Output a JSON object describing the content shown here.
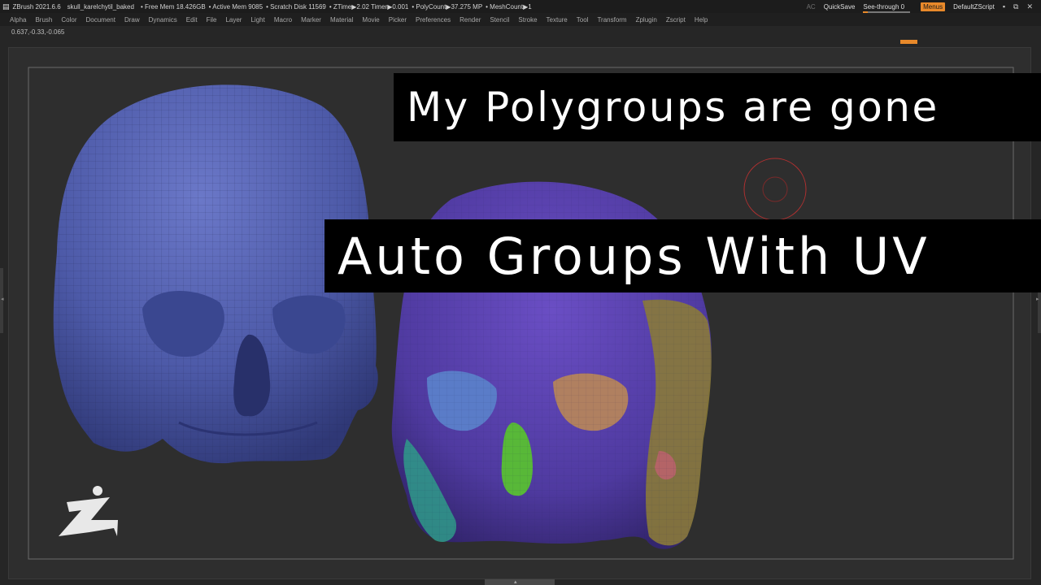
{
  "titlebar": {
    "app": "ZBrush 2021.6.6",
    "file": "skull_karelchytil_baked",
    "free_mem": "• Free Mem 18.426GB",
    "active_mem": "• Active Mem 9085",
    "scratch": "• Scratch Disk 11569",
    "ztime": "• ZTime▶2.02 Timer▶0.001",
    "polycount": "• PolyCount▶37.275 MP",
    "meshcount": "• MeshCount▶1",
    "ac": "AC",
    "quicksave": "QuickSave",
    "see_through": "See-through  0",
    "see_through_value": 0,
    "menus": "Menus",
    "default_script": "DefaultZScript",
    "accent_color": "#e8892a"
  },
  "menubar": {
    "items": [
      "Alpha",
      "Brush",
      "Color",
      "Document",
      "Draw",
      "Dynamics",
      "Edit",
      "File",
      "Layer",
      "Light",
      "Macro",
      "Marker",
      "Material",
      "Movie",
      "Picker",
      "Preferences",
      "Render",
      "Stencil",
      "Stroke",
      "Texture",
      "Tool",
      "Transform",
      "Zplugin",
      "Zscript",
      "Help"
    ]
  },
  "coords": "0.637,-0.33,-0.065",
  "overlay": {
    "line1": "My Polygroups are gone",
    "line2": "Auto Groups With UV"
  },
  "icons": {
    "brush_cursor": "circle-cursor-icon",
    "logo": "zbrush-logo-icon"
  }
}
